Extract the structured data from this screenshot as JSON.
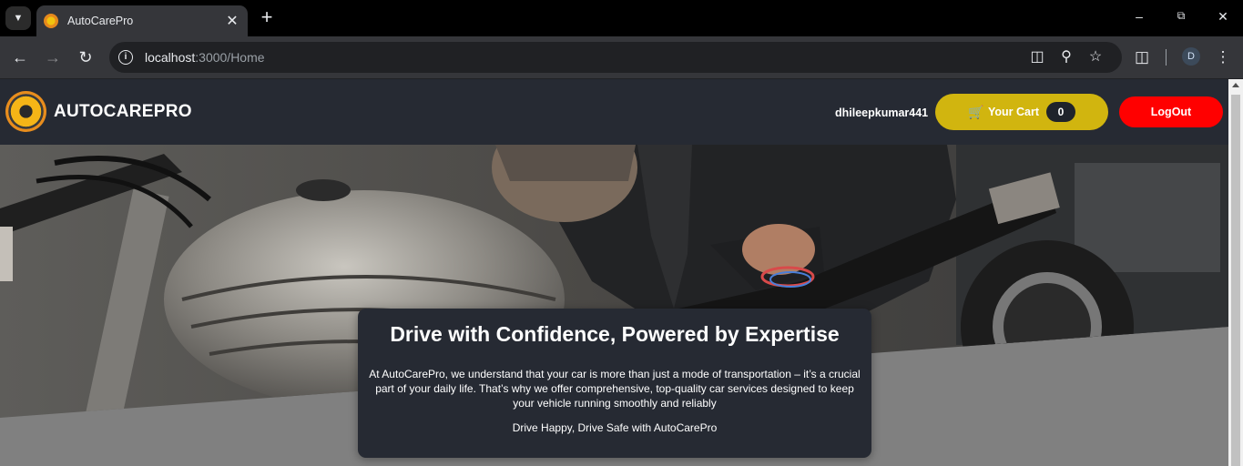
{
  "browser": {
    "tab_title": "AutoCarePro",
    "url_host": "localhost",
    "url_path": ":3000/Home",
    "profile_initial": "D"
  },
  "navbar": {
    "brand": "AUTOCAREPRO",
    "username": "dhileepkumar441",
    "cart_label": "Your Cart",
    "cart_count": "0",
    "logout_label": "LogOut"
  },
  "hero": {
    "title": "Drive with Confidence, Powered by Expertise",
    "description": "At AutoCarePro, we understand that your car is more than just a mode of transportation – it’s a crucial part of your daily life. That’s why we offer comprehensive, top-quality car services designed to keep your vehicle running smoothly and reliably",
    "tagline": "Drive Happy, Drive Safe with AutoCarePro"
  },
  "colors": {
    "navbar_bg": "#262a33",
    "cart_button": "#d1b50f",
    "logout_button": "#ff0000",
    "page_bg": "#808080"
  },
  "icons": {
    "cart": "shopping-cart-icon",
    "info": "info-icon",
    "back": "back-arrow-icon",
    "forward": "forward-arrow-icon",
    "reload": "reload-icon"
  }
}
